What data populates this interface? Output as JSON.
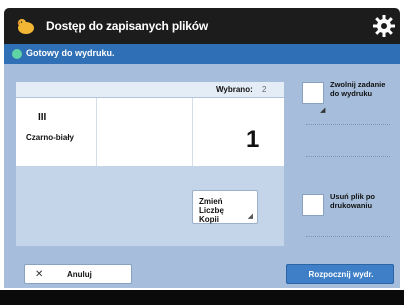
{
  "header": {
    "title": "Dostęp do zapisanych plików",
    "logo_icon": "duck-logo-icon",
    "settings_icon": "gear-icon"
  },
  "status": {
    "message": "Gotowy do wydruku."
  },
  "copies_panel": {
    "selected_label": "Wybrano:",
    "selected_value": "2",
    "mode_glyph": "III",
    "mode_label": "Czarno-biały",
    "copies_value": "1"
  },
  "buttons": {
    "change_copies": "Zmień Liczbę Kopii",
    "cancel": "Anuluj",
    "start_print": "Rozpocznij wydr."
  },
  "options": [
    {
      "label": "Zwolnij zadanie do wydruku",
      "icon": "checkbox-icon"
    },
    {
      "label": "Usuń plik po drukowaniu",
      "icon": "checkbox-icon"
    }
  ],
  "colors": {
    "header": "#1c1c1c",
    "status": "#2f6fb5",
    "panel": "#a6bedb",
    "accent": "#3e7fc7"
  }
}
